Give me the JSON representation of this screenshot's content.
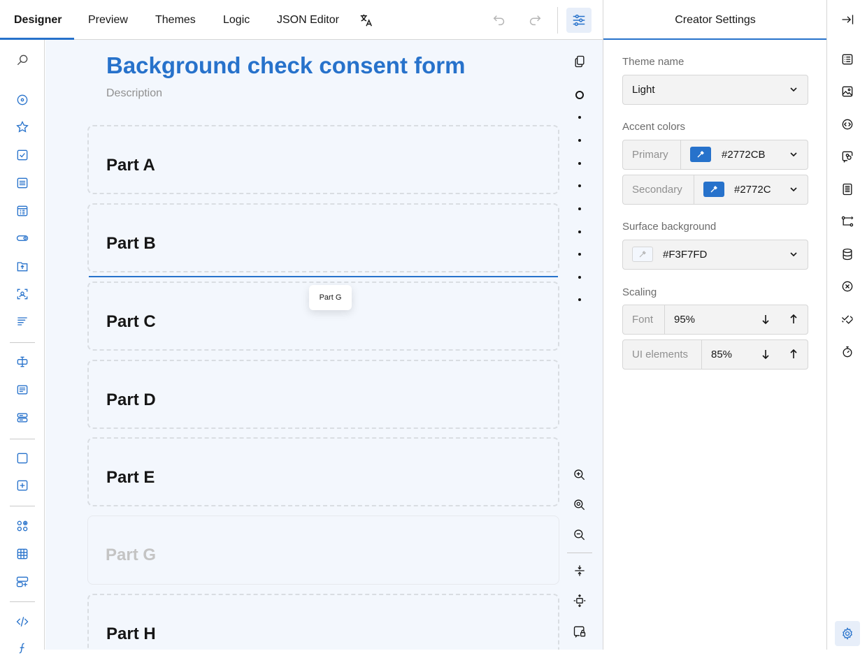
{
  "topbar": {
    "tabs": [
      {
        "label": "Designer",
        "active": true
      },
      {
        "label": "Preview"
      },
      {
        "label": "Themes"
      },
      {
        "label": "Logic"
      },
      {
        "label": "JSON Editor"
      }
    ],
    "icons": [
      "translate-icon",
      "undo-icon",
      "redo-icon",
      "settings-sliders-icon"
    ]
  },
  "form": {
    "title": "Background check consent form",
    "description": "Description",
    "panels": [
      "Part A",
      "Part B",
      "Part C",
      "Part D",
      "Part E",
      "Part G",
      "Part H"
    ],
    "drag_chip": "Part G"
  },
  "settings": {
    "header": "Creator Settings",
    "theme_name_label": "Theme name",
    "theme_name_value": "Light",
    "accent_label": "Accent colors",
    "primary_label": "Primary",
    "primary_value": "#2772CB",
    "secondary_label": "Secondary",
    "secondary_value": "#2772C",
    "surface_label": "Surface background",
    "surface_value": "#F3F7FD",
    "scaling_label": "Scaling",
    "font_label": "Font",
    "font_value": "95%",
    "ui_label": "UI elements",
    "ui_value": "85%"
  },
  "colors": {
    "accent": "#2772CB",
    "surface": "#F3F7FD"
  }
}
